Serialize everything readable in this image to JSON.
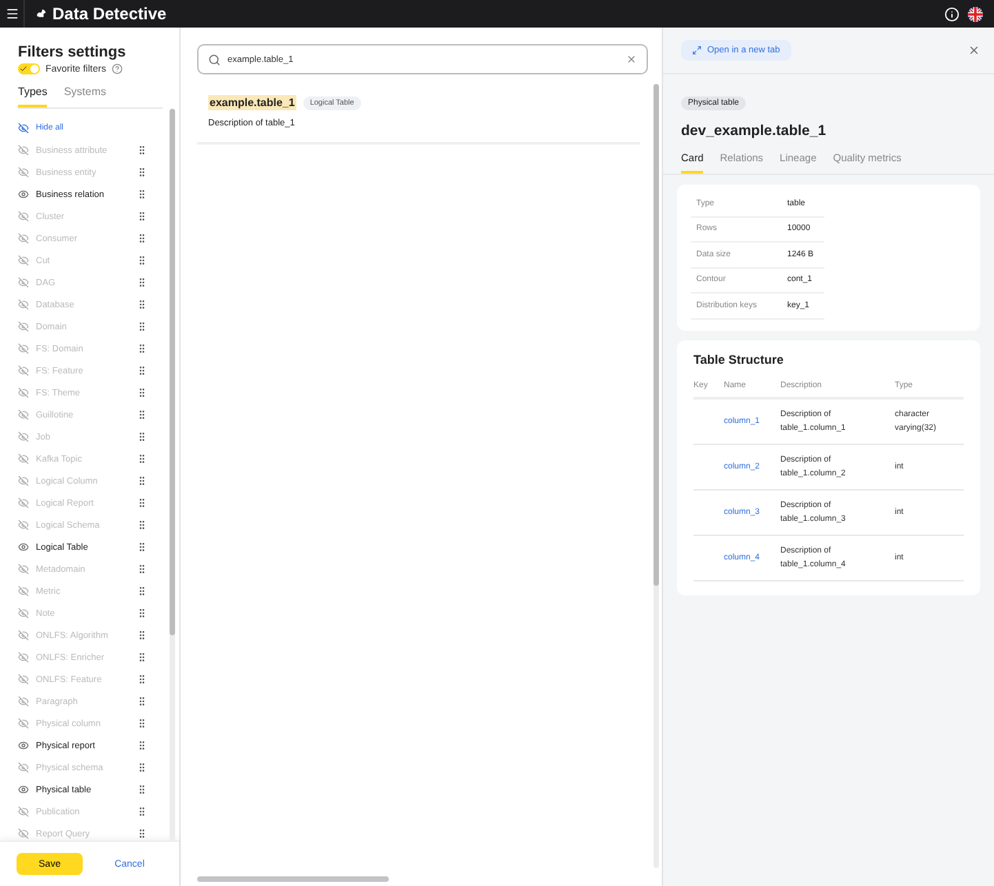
{
  "app": {
    "title": "Data Detective"
  },
  "filters": {
    "title": "Filters settings",
    "favorite_label": "Favorite filters",
    "favorite_on": true,
    "tabs": [
      {
        "label": "Types",
        "selected": true
      },
      {
        "label": "Systems",
        "selected": false
      }
    ],
    "hide_all": "Hide all",
    "items": [
      {
        "label": "Business attribute",
        "visible": false
      },
      {
        "label": "Business entity",
        "visible": false
      },
      {
        "label": "Business relation",
        "visible": true
      },
      {
        "label": "Cluster",
        "visible": false
      },
      {
        "label": "Consumer",
        "visible": false
      },
      {
        "label": "Cut",
        "visible": false
      },
      {
        "label": "DAG",
        "visible": false
      },
      {
        "label": "Database",
        "visible": false
      },
      {
        "label": "Domain",
        "visible": false
      },
      {
        "label": "FS: Domain",
        "visible": false
      },
      {
        "label": "FS: Feature",
        "visible": false
      },
      {
        "label": "FS: Theme",
        "visible": false
      },
      {
        "label": "Guillotine",
        "visible": false
      },
      {
        "label": "Job",
        "visible": false
      },
      {
        "label": "Kafka Topic",
        "visible": false
      },
      {
        "label": "Logical Column",
        "visible": false
      },
      {
        "label": "Logical Report",
        "visible": false
      },
      {
        "label": "Logical Schema",
        "visible": false
      },
      {
        "label": "Logical Table",
        "visible": true
      },
      {
        "label": "Metadomain",
        "visible": false
      },
      {
        "label": "Metric",
        "visible": false
      },
      {
        "label": "Note",
        "visible": false
      },
      {
        "label": "ONLFS: Algorithm",
        "visible": false
      },
      {
        "label": "ONLFS: Enricher",
        "visible": false
      },
      {
        "label": "ONLFS: Feature",
        "visible": false
      },
      {
        "label": "Paragraph",
        "visible": false
      },
      {
        "label": "Physical column",
        "visible": false
      },
      {
        "label": "Physical report",
        "visible": true
      },
      {
        "label": "Physical schema",
        "visible": false
      },
      {
        "label": "Physical table",
        "visible": true
      },
      {
        "label": "Publication",
        "visible": false
      },
      {
        "label": "Report Query",
        "visible": false
      }
    ],
    "save": "Save",
    "cancel": "Cancel"
  },
  "search": {
    "value": "example.table_1",
    "results": [
      {
        "name": "example.table_1",
        "type": "Logical Table",
        "description": "Description of table_1"
      }
    ]
  },
  "detail": {
    "open_new_tab": "Open in a new tab",
    "type_chip": "Physical table",
    "title": "dev_example.table_1",
    "tabs": [
      {
        "label": "Card",
        "selected": true
      },
      {
        "label": "Relations",
        "selected": false
      },
      {
        "label": "Lineage",
        "selected": false
      },
      {
        "label": "Quality metrics",
        "selected": false
      }
    ],
    "properties": [
      {
        "key": "Type",
        "value": "table"
      },
      {
        "key": "Rows",
        "value": "10000"
      },
      {
        "key": "Data size",
        "value": "1246 B"
      },
      {
        "key": "Contour",
        "value": "cont_1"
      },
      {
        "key": "Distribution keys",
        "value": "key_1"
      }
    ],
    "structure": {
      "title": "Table Structure",
      "columns": [
        "Key",
        "Name",
        "Description",
        "Type"
      ],
      "rows": [
        {
          "name": "column_1",
          "description": "Description of table_1.column_1",
          "type": "character varying(32)"
        },
        {
          "name": "column_2",
          "description": "Description of table_1.column_2",
          "type": "int"
        },
        {
          "name": "column_3",
          "description": "Description of table_1.column_3",
          "type": "int"
        },
        {
          "name": "column_4",
          "description": "Description of table_1.column_4",
          "type": "int"
        }
      ]
    }
  }
}
